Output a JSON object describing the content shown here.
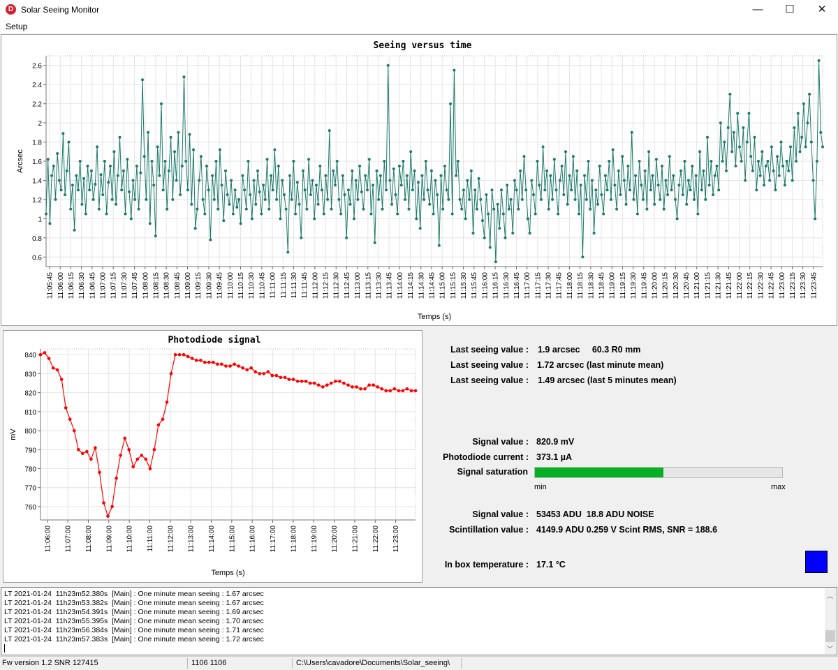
{
  "window": {
    "title": "Solar Seeing Monitor",
    "icon_letter": "D",
    "minimize": "—",
    "maximize": "☐",
    "close": "✕"
  },
  "menu": {
    "setup": "Setup"
  },
  "seeing_chart": {
    "title": "Seeing versus time",
    "ylabel": "Arcsec",
    "xlabel": "Temps (s)",
    "line_color": "#1b7a6a",
    "chart_data": {
      "type": "line",
      "title": "Seeing versus time",
      "xlabel": "Temps (s)",
      "ylabel": "Arcsec",
      "ylim": [
        0.5,
        2.7
      ],
      "y_ticks": [
        0.6,
        0.8,
        1,
        1.2,
        1.4,
        1.6,
        1.8,
        2,
        2.2,
        2.4,
        2.6
      ],
      "x_start": "11:05:40",
      "x_end": "11:23:58",
      "x_ticks": [
        "11:05:45",
        "11:06:00",
        "11:06:15",
        "11:06:30",
        "11:06:45",
        "11:07:00",
        "11:07:15",
        "11:07:30",
        "11:07:45",
        "11:08:00",
        "11:08:15",
        "11:08:30",
        "11:08:45",
        "11:09:00",
        "11:09:15",
        "11:09:30",
        "11:09:45",
        "11:10:00",
        "11:10:15",
        "11:10:30",
        "11:10:45",
        "11:11:00",
        "11:11:15",
        "11:11:30",
        "11:11:45",
        "11:12:00",
        "11:12:15",
        "11:12:30",
        "11:12:45",
        "11:13:00",
        "11:13:15",
        "11:13:30",
        "11:13:45",
        "11:14:00",
        "11:14:15",
        "11:14:30",
        "11:14:45",
        "11:15:00",
        "11:15:15",
        "11:15:30",
        "11:15:45",
        "11:16:00",
        "11:16:15",
        "11:16:30",
        "11:16:45",
        "11:17:00",
        "11:17:15",
        "11:17:30",
        "11:17:45",
        "11:18:00",
        "11:18:15",
        "11:18:30",
        "11:18:45",
        "11:19:00",
        "11:19:15",
        "11:19:30",
        "11:19:45",
        "11:20:00",
        "11:20:15",
        "11:20:30",
        "11:20:45",
        "11:21:00",
        "11:21:15",
        "11:21:30",
        "11:21:45",
        "11:22:00",
        "11:22:15",
        "11:22:30",
        "11:22:45",
        "11:23:00",
        "11:23:15",
        "11:23:30",
        "11:23:45"
      ],
      "series": [
        {
          "values": [
            1.05,
            1.62,
            0.95,
            1.45,
            1.55,
            1.2,
            1.68,
            1.4,
            1.3,
            1.89,
            1.25,
            1.5,
            1.8,
            1.1,
            1.35,
            0.88,
            1.45,
            1.3,
            1.6,
            1.15,
            1.42,
            1.05,
            1.55,
            1.3,
            1.5,
            1.2,
            1.36,
            1.75,
            1.1,
            1.46,
            1.25,
            1.6,
            1.05,
            1.38,
            1.55,
            1.2,
            1.7,
            1.15,
            1.45,
            1.85,
            1.3,
            1.5,
            1.05,
            1.62,
            1.28,
            1.0,
            1.4,
            1.2,
            1.55,
            1.1,
            1.48,
            2.45,
            1.65,
            1.2,
            1.9,
            0.95,
            1.6,
            1.35,
            0.82,
            1.75,
            1.45,
            2.2,
            1.3,
            1.6,
            1.1,
            1.5,
            1.85,
            1.2,
            1.7,
            1.4,
            1.9,
            1.25,
            1.55,
            2.48,
            1.6,
            1.3,
            1.88,
            1.15,
            1.72,
            0.9,
            1.1,
            1.4,
            1.65,
            1.2,
            1.05,
            1.55,
            1.3,
            0.78,
            1.45,
            1.2,
            1.6,
            1.1,
            1.72,
            1.35,
            0.98,
            1.5,
            1.25,
            1.15,
            1.4,
            1.05,
            1.3,
            1.12,
            1.2,
            0.95,
            1.45,
            1.3,
            1.1,
            1.6,
            1.25,
            1.0,
            1.4,
            1.15,
            1.5,
            1.28,
            1.05,
            1.35,
            1.2,
            1.62,
            1.1,
            1.45,
            1.3,
            1.72,
            1.2,
            1.55,
            1.0,
            1.4,
            1.25,
            1.1,
            0.65,
            1.45,
            1.2,
            1.6,
            1.05,
            1.38,
            1.15,
            0.8,
            1.5,
            1.3,
            1.1,
            1.62,
            1.25,
            1.4,
            1.0,
            1.35,
            1.15,
            1.55,
            1.3,
            1.05,
            1.45,
            1.2,
            1.92,
            1.1,
            1.5,
            1.35,
            1.6,
            1.2,
            1.05,
            1.45,
            1.25,
            0.8,
            1.3,
            1.15,
            1.5,
            1.0,
            1.4,
            1.2,
            1.55,
            1.28,
            1.1,
            1.45,
            1.3,
            1.62,
            1.05,
            1.35,
            0.75,
            1.5,
            1.2,
            1.45,
            1.1,
            1.6,
            1.3,
            2.6,
            1.4,
            1.15,
            1.52,
            1.25,
            1.05,
            1.55,
            1.35,
            1.6,
            1.2,
            1.45,
            1.1,
            1.7,
            1.3,
            1.5,
            1.0,
            1.38,
            0.9,
            1.45,
            1.2,
            1.6,
            1.3,
            1.15,
            1.5,
            1.05,
            1.4,
            1.25,
            0.72,
            1.45,
            1.1,
            1.55,
            1.3,
            1.2,
            2.2,
            1.05,
            2.55,
            1.45,
            1.6,
            1.2,
            1.1,
            1.3,
            1.0,
            1.4,
            1.2,
            1.5,
            0.85,
            1.3,
            1.1,
            1.42,
            1.2,
            0.98,
            0.8,
            1.25,
            1.05,
            0.7,
            1.3,
            1.1,
            0.55,
            1.15,
            0.9,
            1.3,
            1.05,
            0.8,
            1.35,
            1.1,
            1.2,
            0.85,
            1.4,
            1.3,
            1.1,
            1.5,
            1.2,
            1.65,
            1.3,
            1.0,
            0.85,
            1.4,
            1.25,
            1.05,
            1.6,
            1.35,
            1.2,
            1.75,
            1.3,
            1.5,
            1.1,
            1.45,
            1.2,
            1.62,
            1.3,
            1.05,
            1.4,
            1.55,
            1.25,
            1.7,
            1.15,
            1.45,
            1.3,
            1.65,
            1.2,
            1.5,
            1.05,
            1.35,
            0.6,
            1.45,
            1.2,
            1.6,
            1.1,
            1.4,
            0.85,
            1.3,
            1.15,
            1.55,
            1.25,
            1.05,
            1.45,
            1.3,
            1.6,
            1.2,
            1.72,
            1.35,
            1.1,
            1.5,
            1.25,
            1.65,
            1.4,
            1.15,
            1.55,
            1.3,
            1.9,
            1.2,
            1.45,
            1.05,
            1.6,
            1.35,
            1.2,
            1.5,
            1.1,
            1.7,
            1.3,
            1.45,
            1.15,
            1.62,
            1.35,
            1.2,
            1.55,
            1.1,
            1.4,
            1.25,
            1.65,
            1.3,
            1.45,
            1.2,
            1.0,
            1.35,
            1.5,
            1.25,
            1.6,
            1.15,
            1.4,
            1.3,
            1.55,
            1.2,
            1.45,
            1.05,
            1.7,
            1.3,
            1.5,
            1.2,
            1.85,
            1.35,
            1.6,
            1.25,
            1.45,
            1.55,
            1.3,
            2.0,
            1.6,
            1.8,
            1.5,
            1.95,
            2.3,
            1.7,
            1.9,
            1.55,
            2.1,
            1.75,
            1.6,
            1.95,
            1.4,
            1.8,
            2.1,
            1.65,
            1.5,
            1.85,
            1.3,
            1.6,
            1.45,
            1.7,
            1.35,
            1.55,
            1.6,
            1.4,
            1.75,
            1.5,
            1.3,
            1.65,
            1.45,
            1.8,
            1.55,
            1.35,
            1.6,
            1.5,
            1.75,
            1.4,
            1.95,
            1.6,
            2.1,
            1.7,
            1.85,
            2.2,
            1.75,
            2.0,
            2.3,
            1.8,
            1.4,
            1.0,
            1.6,
            2.65,
            1.9,
            1.75
          ]
        }
      ]
    }
  },
  "photodiode_chart": {
    "title": "Photodiode signal",
    "ylabel": "mV",
    "xlabel": "Temps (s)",
    "line_color": "#ff0000",
    "chart_data": {
      "type": "line",
      "title": "Photodiode signal",
      "xlabel": "Temps (s)",
      "ylabel": "mV",
      "ylim": [
        753,
        843
      ],
      "y_ticks": [
        760,
        770,
        780,
        790,
        800,
        810,
        820,
        830,
        840
      ],
      "x_start": "11:05:40",
      "x_end": "11:23:58",
      "x_ticks": [
        "11:06:00",
        "11:07:00",
        "11:08:00",
        "11:09:00",
        "11:10:00",
        "11:11:00",
        "11:12:00",
        "11:13:00",
        "11:14:00",
        "11:15:00",
        "11:16:00",
        "11:17:00",
        "11:18:00",
        "11:19:00",
        "11:20:00",
        "11:21:00",
        "11:22:00",
        "11:23:00"
      ],
      "series": [
        {
          "values": [
            840,
            841,
            838,
            833,
            832,
            827,
            812,
            806,
            800,
            790,
            788,
            789,
            785,
            791,
            778,
            762,
            755,
            760,
            775,
            787,
            796,
            790,
            781,
            785,
            787,
            785,
            780,
            790,
            803,
            806,
            815,
            830,
            840,
            840,
            840,
            839,
            838,
            837,
            837,
            836,
            836,
            836,
            835,
            835,
            834,
            834,
            835,
            834,
            833,
            832,
            833,
            831,
            830,
            830,
            831,
            829,
            829,
            828,
            828,
            827,
            827,
            826,
            826,
            826,
            825,
            825,
            824,
            823,
            824,
            825,
            826,
            826,
            825,
            824,
            823,
            823,
            822,
            822,
            824,
            824,
            823,
            822,
            821,
            821,
            822,
            821,
            821,
            822,
            821,
            821
          ]
        }
      ]
    }
  },
  "info": {
    "last_seeing_1_label": "Last seeing value :",
    "last_seeing_1_value": "1.9 arcsec     60.3 R0 mm",
    "last_seeing_2_label": "Last seeing value :",
    "last_seeing_2_value": "1.72 arcsec (last minute mean)",
    "last_seeing_3_label": "Last seeing value :",
    "last_seeing_3_value": "1.49 arcsec (last 5 minutes mean)",
    "signal_label": "Signal value :",
    "signal_value": "820.9 mV",
    "current_label": "Photodiode current :",
    "current_value": "373.1 µA",
    "saturation_label": "Signal saturation",
    "saturation_fraction": 0.52,
    "saturation_color": "#06b025",
    "min_label": "min",
    "max_label": "max",
    "adu_label": "Signal value :",
    "adu_value": "53453 ADU  18.8 ADU NOISE",
    "scint_label": "Scintillation value :",
    "scint_value": "4149.9 ADU 0.259 V Scint RMS, SNR = 188.6",
    "temp_label": "In box temperature :",
    "temp_value": "17.1 °C",
    "temp_indicator_color": "#0000ff"
  },
  "log": [
    "LT 2021-01-24  11h23m52.380s  [Main] : One minute mean seeing : 1.67 arcsec",
    "LT 2021-01-24  11h23m53.382s  [Main] : One minute mean seeing : 1.67 arcsec",
    "LT 2021-01-24  11h23m54.391s  [Main] : One minute mean seeing : 1.69 arcsec",
    "LT 2021-01-24  11h23m55.395s  [Main] : One minute mean seeing : 1.70 arcsec",
    "LT 2021-01-24  11h23m56.384s  [Main] : One minute mean seeing : 1.71 arcsec",
    "LT 2021-01-24  11h23m57.383s  [Main] : One minute mean seeing : 1.72 arcsec"
  ],
  "status": {
    "fw": "Fw version 1.2 SNR 127415",
    "coords": "1106  1106",
    "path": "C:\\Users\\cavadore\\Documents\\Solar_seeing\\"
  }
}
